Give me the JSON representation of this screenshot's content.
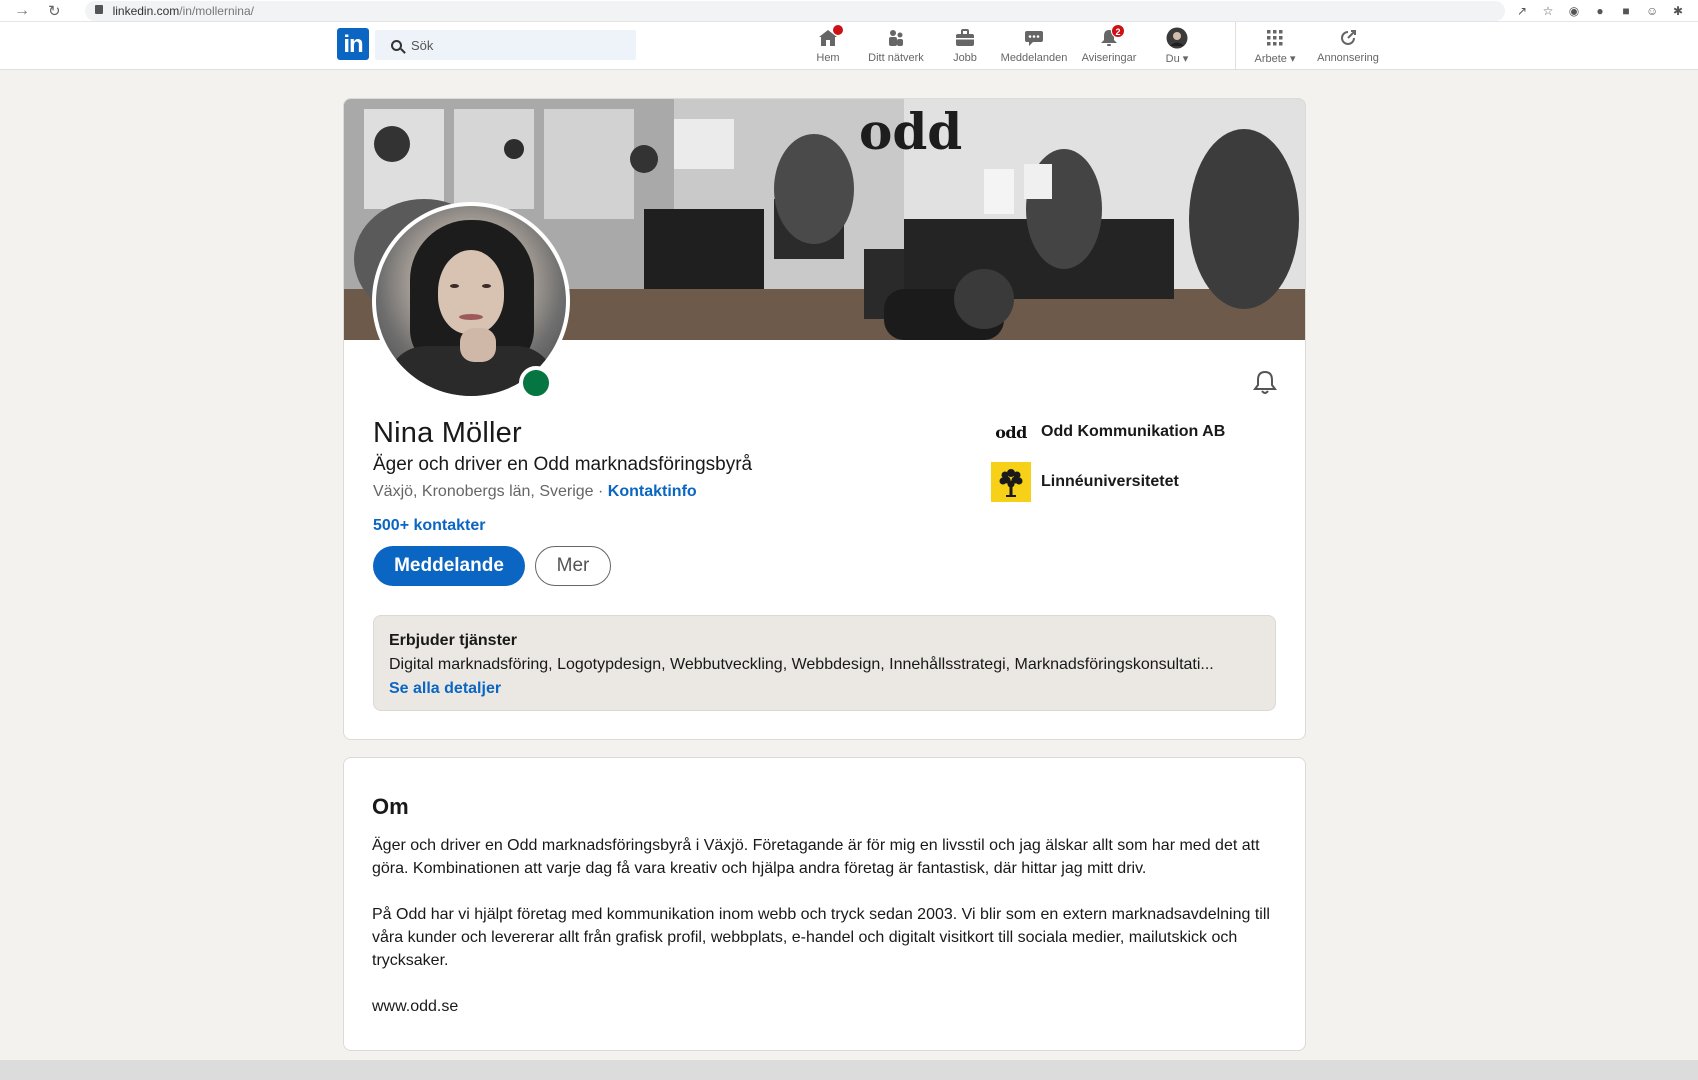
{
  "browser": {
    "url_host": "linkedin.com",
    "url_path": "/in/mollernina/"
  },
  "nav": {
    "search_placeholder": "Sök",
    "items": [
      {
        "label": "Hem",
        "icon": "home-icon",
        "badge": ""
      },
      {
        "label": "Ditt nätverk",
        "icon": "network-icon",
        "badge": ""
      },
      {
        "label": "Jobb",
        "icon": "briefcase-icon",
        "badge": ""
      },
      {
        "label": "Meddelanden",
        "icon": "messaging-icon",
        "badge": ""
      },
      {
        "label": "Aviseringar",
        "icon": "bell-icon",
        "badge": "2"
      },
      {
        "label": "Du",
        "icon": "avatar-icon",
        "badge": ""
      },
      {
        "label": "Arbete",
        "icon": "grid-icon",
        "badge": ""
      },
      {
        "label": "Annonsering",
        "icon": "advertise-icon",
        "badge": ""
      }
    ]
  },
  "banner": {
    "logo_text": "odd"
  },
  "profile": {
    "name": "Nina Möller",
    "headline": "Äger och driver en Odd marknadsföringsbyrå",
    "location": "Växjö, Kronobergs län, Sverige",
    "separator": " · ",
    "contact_link": "Kontaktinfo",
    "connections": "500+ kontakter",
    "primary_button": "Meddelande",
    "secondary_button": "Mer",
    "online_status_color": "#057642"
  },
  "organizations": [
    {
      "name": "Odd Kommunikation AB",
      "logo_text": "odd"
    },
    {
      "name": "Linnéuniversitetet",
      "logo_icon": "tree-icon"
    }
  ],
  "services": {
    "title": "Erbjuder tjänster",
    "list": "Digital marknadsföring, Logotypdesign, Webbutveckling, Webbdesign, Innehållsstrategi, Marknadsföringskonsultati...",
    "details_link": "Se alla detaljer"
  },
  "about": {
    "title": "Om",
    "paragraphs": [
      "Äger och driver en Odd marknadsföringsbyrå i Växjö. Företagande är för mig en livsstil och jag älskar allt som har med det att göra. Kombinationen att varje dag få vara kreativ och hjälpa andra företag är fantastisk, där hittar jag mitt driv.",
      "På Odd har vi hjälpt företag med kommunikation inom webb och tryck sedan 2003. Vi blir som en extern marknadsavdelning till våra kunder och levererar allt från grafisk profil, webbplats, e-handel och digitalt visitkort till sociala medier, mailutskick och trycksaker.",
      "www.odd.se"
    ]
  },
  "colors": {
    "brand": "#0a66c2",
    "background": "#f3f2ef",
    "badge": "#cc1016"
  }
}
